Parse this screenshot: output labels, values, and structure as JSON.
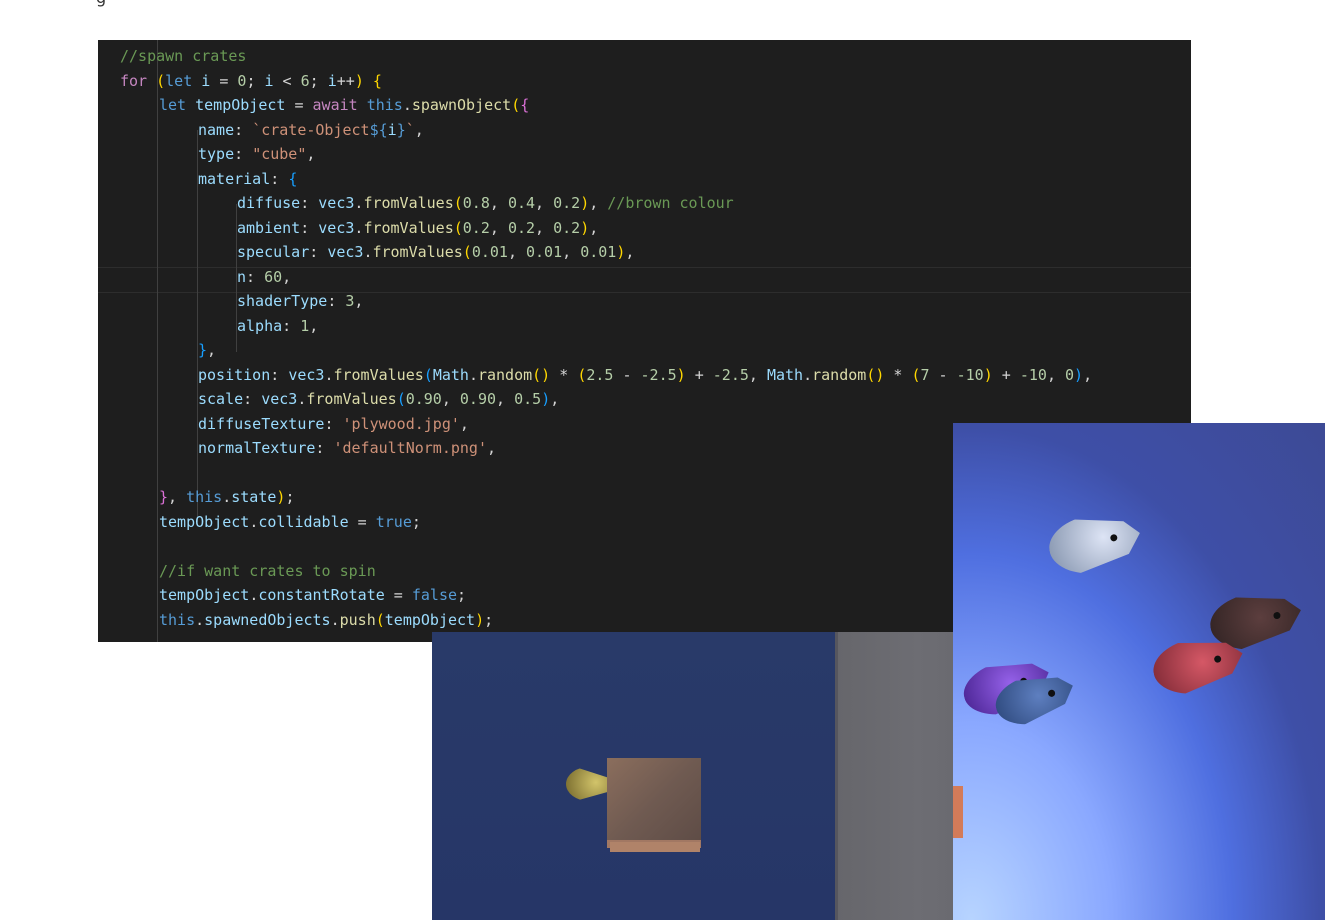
{
  "fragment": "g",
  "code_lines": [
    {
      "indent": 1,
      "tokens": [
        {
          "t": "//spawn crates",
          "c": "m"
        }
      ]
    },
    {
      "indent": 1,
      "tokens": [
        {
          "t": "for",
          "c": "c"
        },
        {
          "t": " (",
          "c": "b1"
        },
        {
          "t": "let",
          "c": "k"
        },
        {
          "t": " i",
          "c": "v"
        },
        {
          "t": " = ",
          "c": "p"
        },
        {
          "t": "0",
          "c": "n"
        },
        {
          "t": "; ",
          "c": "p"
        },
        {
          "t": "i",
          "c": "v"
        },
        {
          "t": " < ",
          "c": "p"
        },
        {
          "t": "6",
          "c": "n"
        },
        {
          "t": "; ",
          "c": "p"
        },
        {
          "t": "i",
          "c": "v"
        },
        {
          "t": "++",
          "c": "p"
        },
        {
          "t": ") {",
          "c": "b1"
        }
      ]
    },
    {
      "indent": 2,
      "tokens": [
        {
          "t": "let",
          "c": "k"
        },
        {
          "t": " tempObject",
          "c": "v"
        },
        {
          "t": " = ",
          "c": "p"
        },
        {
          "t": "await",
          "c": "c"
        },
        {
          "t": " this",
          "c": "k"
        },
        {
          "t": ".",
          "c": "p"
        },
        {
          "t": "spawnObject",
          "c": "f"
        },
        {
          "t": "(",
          "c": "b1"
        },
        {
          "t": "{",
          "c": "b2"
        }
      ]
    },
    {
      "indent": 3,
      "tokens": [
        {
          "t": "name",
          "c": "v"
        },
        {
          "t": ": ",
          "c": "p"
        },
        {
          "t": "`crate-Object",
          "c": "s"
        },
        {
          "t": "${",
          "c": "k"
        },
        {
          "t": "i",
          "c": "v"
        },
        {
          "t": "}",
          "c": "k"
        },
        {
          "t": "`",
          "c": "s"
        },
        {
          "t": ",",
          "c": "p"
        }
      ]
    },
    {
      "indent": 3,
      "tokens": [
        {
          "t": "type",
          "c": "v"
        },
        {
          "t": ": ",
          "c": "p"
        },
        {
          "t": "\"cube\"",
          "c": "s"
        },
        {
          "t": ",",
          "c": "p"
        }
      ]
    },
    {
      "indent": 3,
      "tokens": [
        {
          "t": "material",
          "c": "v"
        },
        {
          "t": ": ",
          "c": "p"
        },
        {
          "t": "{",
          "c": "b3"
        }
      ]
    },
    {
      "indent": 4,
      "tokens": [
        {
          "t": "diffuse",
          "c": "v"
        },
        {
          "t": ": ",
          "c": "p"
        },
        {
          "t": "vec3",
          "c": "v"
        },
        {
          "t": ".",
          "c": "p"
        },
        {
          "t": "fromValues",
          "c": "f"
        },
        {
          "t": "(",
          "c": "b1"
        },
        {
          "t": "0.8",
          "c": "n"
        },
        {
          "t": ", ",
          "c": "p"
        },
        {
          "t": "0.4",
          "c": "n"
        },
        {
          "t": ", ",
          "c": "p"
        },
        {
          "t": "0.2",
          "c": "n"
        },
        {
          "t": ")",
          "c": "b1"
        },
        {
          "t": ", ",
          "c": "p"
        },
        {
          "t": "//brown colour",
          "c": "m"
        }
      ]
    },
    {
      "indent": 4,
      "tokens": [
        {
          "t": "ambient",
          "c": "v"
        },
        {
          "t": ": ",
          "c": "p"
        },
        {
          "t": "vec3",
          "c": "v"
        },
        {
          "t": ".",
          "c": "p"
        },
        {
          "t": "fromValues",
          "c": "f"
        },
        {
          "t": "(",
          "c": "b1"
        },
        {
          "t": "0.2",
          "c": "n"
        },
        {
          "t": ", ",
          "c": "p"
        },
        {
          "t": "0.2",
          "c": "n"
        },
        {
          "t": ", ",
          "c": "p"
        },
        {
          "t": "0.2",
          "c": "n"
        },
        {
          "t": ")",
          "c": "b1"
        },
        {
          "t": ",",
          "c": "p"
        }
      ]
    },
    {
      "indent": 4,
      "tokens": [
        {
          "t": "specular",
          "c": "v"
        },
        {
          "t": ": ",
          "c": "p"
        },
        {
          "t": "vec3",
          "c": "v"
        },
        {
          "t": ".",
          "c": "p"
        },
        {
          "t": "fromValues",
          "c": "f"
        },
        {
          "t": "(",
          "c": "b1"
        },
        {
          "t": "0.01",
          "c": "n"
        },
        {
          "t": ", ",
          "c": "p"
        },
        {
          "t": "0.01",
          "c": "n"
        },
        {
          "t": ", ",
          "c": "p"
        },
        {
          "t": "0.01",
          "c": "n"
        },
        {
          "t": ")",
          "c": "b1"
        },
        {
          "t": ",",
          "c": "p"
        }
      ]
    },
    {
      "indent": 4,
      "tokens": [
        {
          "t": "n",
          "c": "v"
        },
        {
          "t": ": ",
          "c": "p"
        },
        {
          "t": "60",
          "c": "n"
        },
        {
          "t": ",",
          "c": "p"
        }
      ]
    },
    {
      "indent": 4,
      "tokens": [
        {
          "t": "shaderType",
          "c": "v"
        },
        {
          "t": ": ",
          "c": "p"
        },
        {
          "t": "3",
          "c": "n"
        },
        {
          "t": ",",
          "c": "p"
        }
      ]
    },
    {
      "indent": 4,
      "tokens": [
        {
          "t": "alpha",
          "c": "v"
        },
        {
          "t": ": ",
          "c": "p"
        },
        {
          "t": "1",
          "c": "n"
        },
        {
          "t": ",",
          "c": "p"
        }
      ]
    },
    {
      "indent": 3,
      "tokens": [
        {
          "t": "}",
          "c": "b3"
        },
        {
          "t": ",",
          "c": "p"
        }
      ]
    },
    {
      "indent": 3,
      "tokens": [
        {
          "t": "position",
          "c": "v"
        },
        {
          "t": ": ",
          "c": "p"
        },
        {
          "t": "vec3",
          "c": "v"
        },
        {
          "t": ".",
          "c": "p"
        },
        {
          "t": "fromValues",
          "c": "f"
        },
        {
          "t": "(",
          "c": "b3"
        },
        {
          "t": "Math",
          "c": "v"
        },
        {
          "t": ".",
          "c": "p"
        },
        {
          "t": "random",
          "c": "f"
        },
        {
          "t": "()",
          "c": "b1"
        },
        {
          "t": " * ",
          "c": "p"
        },
        {
          "t": "(",
          "c": "b1"
        },
        {
          "t": "2.5",
          "c": "n"
        },
        {
          "t": " - ",
          "c": "p"
        },
        {
          "t": "-2.5",
          "c": "n"
        },
        {
          "t": ")",
          "c": "b1"
        },
        {
          "t": " + ",
          "c": "p"
        },
        {
          "t": "-2.5",
          "c": "n"
        },
        {
          "t": ", ",
          "c": "p"
        },
        {
          "t": "Math",
          "c": "v"
        },
        {
          "t": ".",
          "c": "p"
        },
        {
          "t": "random",
          "c": "f"
        },
        {
          "t": "()",
          "c": "b1"
        },
        {
          "t": " * ",
          "c": "p"
        },
        {
          "t": "(",
          "c": "b1"
        },
        {
          "t": "7",
          "c": "n"
        },
        {
          "t": " - ",
          "c": "p"
        },
        {
          "t": "-10",
          "c": "n"
        },
        {
          "t": ")",
          "c": "b1"
        },
        {
          "t": " + ",
          "c": "p"
        },
        {
          "t": "-10",
          "c": "n"
        },
        {
          "t": ", ",
          "c": "p"
        },
        {
          "t": "0",
          "c": "n"
        },
        {
          "t": ")",
          "c": "b3"
        },
        {
          "t": ",",
          "c": "p"
        }
      ]
    },
    {
      "indent": 3,
      "tokens": [
        {
          "t": "scale",
          "c": "v"
        },
        {
          "t": ": ",
          "c": "p"
        },
        {
          "t": "vec3",
          "c": "v"
        },
        {
          "t": ".",
          "c": "p"
        },
        {
          "t": "fromValues",
          "c": "f"
        },
        {
          "t": "(",
          "c": "b3"
        },
        {
          "t": "0.90",
          "c": "n"
        },
        {
          "t": ", ",
          "c": "p"
        },
        {
          "t": "0.90",
          "c": "n"
        },
        {
          "t": ", ",
          "c": "p"
        },
        {
          "t": "0.5",
          "c": "n"
        },
        {
          "t": ")",
          "c": "b3"
        },
        {
          "t": ",",
          "c": "p"
        }
      ]
    },
    {
      "indent": 3,
      "tokens": [
        {
          "t": "diffuseTexture",
          "c": "v"
        },
        {
          "t": ": ",
          "c": "p"
        },
        {
          "t": "'plywood.jpg'",
          "c": "s"
        },
        {
          "t": ",",
          "c": "p"
        }
      ]
    },
    {
      "indent": 3,
      "tokens": [
        {
          "t": "normalTexture",
          "c": "v"
        },
        {
          "t": ": ",
          "c": "p"
        },
        {
          "t": "'defaultNorm.png'",
          "c": "s"
        },
        {
          "t": ",",
          "c": "p"
        }
      ]
    },
    {
      "indent": 2,
      "tokens": []
    },
    {
      "indent": 2,
      "tokens": [
        {
          "t": "}",
          "c": "b2"
        },
        {
          "t": ", ",
          "c": "p"
        },
        {
          "t": "this",
          "c": "k"
        },
        {
          "t": ".",
          "c": "p"
        },
        {
          "t": "state",
          "c": "v"
        },
        {
          "t": ")",
          "c": "b1"
        },
        {
          "t": ";",
          "c": "p"
        }
      ]
    },
    {
      "indent": 2,
      "tokens": [
        {
          "t": "tempObject",
          "c": "v"
        },
        {
          "t": ".",
          "c": "p"
        },
        {
          "t": "collidable",
          "c": "v"
        },
        {
          "t": " = ",
          "c": "p"
        },
        {
          "t": "true",
          "c": "k"
        },
        {
          "t": ";",
          "c": "p"
        }
      ]
    },
    {
      "indent": 2,
      "tokens": []
    },
    {
      "indent": 2,
      "tokens": [
        {
          "t": "//if want crates to spin",
          "c": "m"
        }
      ]
    },
    {
      "indent": 2,
      "tokens": [
        {
          "t": "tempObject",
          "c": "v"
        },
        {
          "t": ".",
          "c": "p"
        },
        {
          "t": "constantRotate",
          "c": "v"
        },
        {
          "t": " = ",
          "c": "p"
        },
        {
          "t": "false",
          "c": "k"
        },
        {
          "t": ";",
          "c": "p"
        }
      ]
    },
    {
      "indent": 2,
      "tokens": [
        {
          "t": "this",
          "c": "k"
        },
        {
          "t": ".",
          "c": "p"
        },
        {
          "t": "spawnedObjects",
          "c": "v"
        },
        {
          "t": ".",
          "c": "p"
        },
        {
          "t": "push",
          "c": "f"
        },
        {
          "t": "(",
          "c": "b1"
        },
        {
          "t": "tempObject",
          "c": "v"
        },
        {
          "t": ")",
          "c": "b1"
        },
        {
          "t": ";",
          "c": "p"
        }
      ]
    }
  ],
  "scene_left": {
    "objects": [
      "crate",
      "fish",
      "wall"
    ]
  },
  "scene_right": {
    "objects": [
      "fish-silver",
      "fish-dark-red",
      "fish-red",
      "fish-purple",
      "fish-blue"
    ]
  }
}
